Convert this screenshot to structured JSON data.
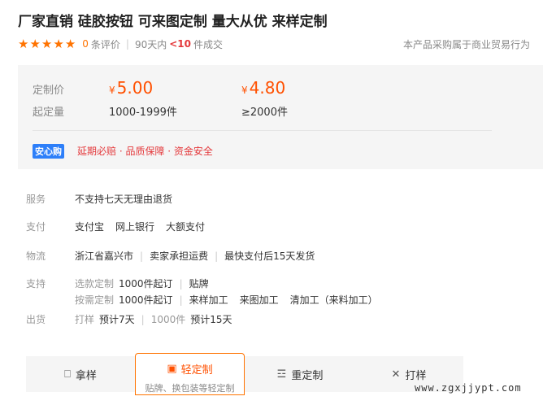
{
  "product": {
    "title": "厂家直销 硅胶按钮 可来图定制 量大从优 来样定制"
  },
  "rating": {
    "review_count": "0",
    "review_label": "条评价",
    "days_label": "90天内",
    "deal_count": "<10",
    "deal_label": "件成交",
    "trade_note": "本产品采购属于商业贸易行为"
  },
  "pricing": {
    "price_label": "定制价",
    "qty_label": "起定量",
    "currency": "¥",
    "tiers": [
      {
        "price": "5.00",
        "qty": "1000-1999件"
      },
      {
        "price": "4.80",
        "qty": "≥2000件"
      }
    ],
    "badge": "安心购",
    "guarantee": "延期必赔 · 品质保障 · 资金安全"
  },
  "info": {
    "service_label": "服务",
    "service_value": "不支持七天无理由退货",
    "pay_label": "支付",
    "pay_methods": [
      "支付宝",
      "网上银行",
      "大额支付"
    ],
    "logistics_label": "物流",
    "logistics_items": [
      "浙江省嘉兴市",
      "卖家承担运费",
      "最快支付后15天发货"
    ],
    "support_label": "支持",
    "support_line1_type": "选款定制",
    "support_line1_moq": "1000件起订",
    "support_line1_items": [
      "贴牌"
    ],
    "support_line2_type": "按需定制",
    "support_line2_moq": "1000件起订",
    "support_line2_items": [
      "来样加工",
      "来图加工",
      "清加工（来料加工）"
    ],
    "ship_label": "出货",
    "ship_sample": "打样",
    "ship_sample_time": "预计7天",
    "ship_bulk": "1000件",
    "ship_bulk_time": "预计15天"
  },
  "tabs": {
    "sample": "拿样",
    "light_custom": "轻定制",
    "light_custom_sub": "贴牌、换包装等轻定制",
    "heavy_custom": "重定制",
    "proofing": "打样"
  },
  "watermark": "www.zgxjjypt.com",
  "colors": {
    "accent": "#ff7300",
    "price": "#ff5000",
    "badge": "#2d7ff9",
    "guarantee": "#e4393c"
  }
}
